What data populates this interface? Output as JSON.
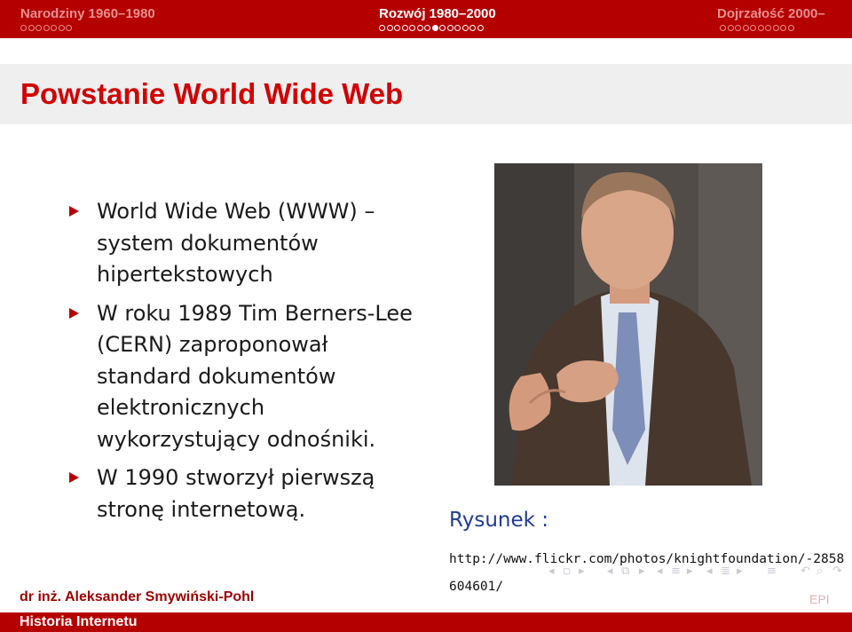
{
  "header": {
    "sections": [
      {
        "label": "Narodziny 1960–1980",
        "dots": 7,
        "current": null,
        "active": false
      },
      {
        "label": "Rozwój 1980–2000",
        "dots": 14,
        "current": 7,
        "active": true
      },
      {
        "label": "Dojrzałość 2000–",
        "dots": 10,
        "current": null,
        "active": false
      }
    ]
  },
  "slide": {
    "title": "Powstanie World Wide Web",
    "bullets": [
      "World Wide Web (WWW) – system dokumentów hipertekstowych",
      "W roku 1989 Tim Berners-Lee (CERN) zaproponował standard dokumentów elektronicznych wykorzystujący odnośniki.",
      "W 1990 stworzył pierwszą stronę internetową."
    ],
    "figure": {
      "label": "Rysunek :",
      "url": "http://www.flickr.com/photos/knightfoundation/-2858604601/"
    }
  },
  "footer": {
    "author": "dr inż. Aleksander Smywiński-Pohl",
    "course": "Historia Internetu",
    "logo_text": "EPI"
  },
  "nav_icons": [
    "first-slide-icon",
    "prev-slide-icon",
    "next-slide-icon",
    "prev-section-icon",
    "next-section-icon",
    "find-icon",
    "undo-icon",
    "redo-icon"
  ],
  "colors": {
    "bar": "#b50000",
    "title": "#d10000",
    "caption": "#1f3a93",
    "bullet": "#b50000"
  }
}
